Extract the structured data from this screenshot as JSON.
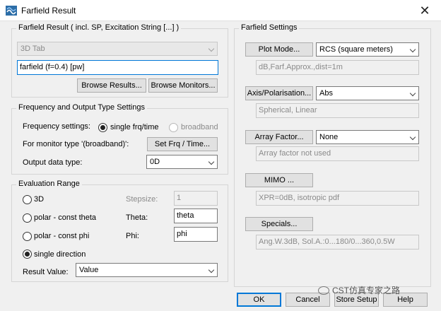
{
  "window": {
    "title": "Farfield Result",
    "close_glyph": "✕"
  },
  "farfield_result": {
    "group_title": "Farfield Result ( incl. SP, Excitation String [...] )",
    "tab_select": "3D Tab",
    "result_name": "farfield (f=0.4) [pw]",
    "browse_results": "Browse Results...",
    "browse_monitors": "Browse Monitors..."
  },
  "frequency": {
    "group_title": "Frequency and Output Type Settings",
    "settings_label": "Frequency settings:",
    "single_label": "single frq/time",
    "broadband_label": "broadband",
    "monitor_label": "For monitor type '(broadband)':",
    "set_button": "Set Frq / Time...",
    "output_label": "Output data type:",
    "output_value": "0D"
  },
  "evaluation": {
    "group_title": "Evaluation Range",
    "opt_3d": "3D",
    "opt_polar_theta": "polar - const theta",
    "opt_polar_phi": "polar - const phi",
    "opt_single": "single direction",
    "stepsize_label": "Stepsize:",
    "stepsize_value": "1",
    "theta_label": "Theta:",
    "theta_value": "theta",
    "phi_label": "Phi:",
    "phi_value": "phi",
    "result_label": "Result Value:",
    "result_value": "Value"
  },
  "settings": {
    "group_title": "Farfield Settings",
    "plot_mode_button": "Plot Mode...",
    "plot_mode_value": "RCS (square meters)",
    "plot_mode_info": "dB,Farf.Approx.,dist=1m",
    "axis_button": "Axis/Polarisation...",
    "axis_value": "Abs",
    "axis_info": "Spherical, Linear",
    "array_button": "Array Factor...",
    "array_value": "None",
    "array_info": "Array factor not used",
    "mimo_button": "MIMO ...",
    "mimo_info": "XPR=0dB, isotropic pdf",
    "specials_button": "Specials...",
    "specials_info": "Ang.W.3dB, Sol.A.:0...180/0...360,0.5W"
  },
  "footer": {
    "ok": "OK",
    "cancel": "Cancel",
    "store": "Store Setup",
    "help": "Help",
    "watermark": "CST仿真专家之路"
  }
}
